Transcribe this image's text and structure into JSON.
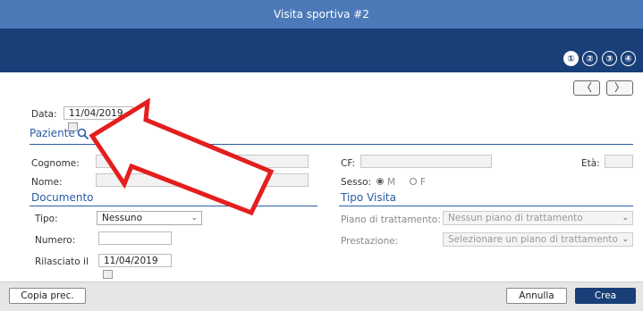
{
  "window": {
    "title": "Visita sportiva #2"
  },
  "steps": [
    "①",
    "②",
    "③",
    "④"
  ],
  "nav": {
    "prev": "〈",
    "next": "〉"
  },
  "date": {
    "label": "Data:",
    "value": "11/04/2019"
  },
  "paziente": {
    "title": "Paziente"
  },
  "fields": {
    "cognome": "Cognome:",
    "nome": "Nome:",
    "cf": "CF:",
    "eta": "Età:",
    "sesso": "Sesso:",
    "sesso_m": "M",
    "sesso_f": "F"
  },
  "documento": {
    "title": "Documento",
    "tipo_label": "Tipo:",
    "tipo_value": "Nessuno",
    "numero_label": "Numero:",
    "rilasciato_label": "Rilasciato il",
    "rilasciato_value": "11/04/2019"
  },
  "tipo_visita": {
    "title": "Tipo Visita",
    "piano_label": "Piano di trattamento:",
    "piano_value": "Nessun piano di trattamento",
    "prestazione_label": "Prestazione:",
    "prestazione_value": "Selezionare un piano di trattamento"
  },
  "footer": {
    "copy": "Copia prec.",
    "cancel": "Annulla",
    "create": "Crea"
  },
  "colors": {
    "header": "#183f78",
    "titlebar": "#4c7ab8",
    "accent": "#2a5ca6",
    "arrow": "#e41e1e"
  }
}
